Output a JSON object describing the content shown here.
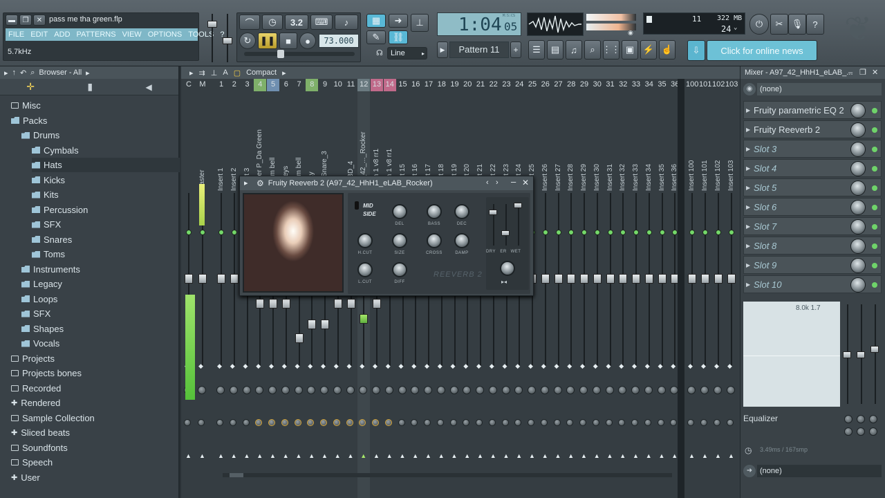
{
  "window": {
    "file_title": "pass me tha green.flp",
    "hint": "5.7kHz"
  },
  "menu": [
    "FILE",
    "EDIT",
    "ADD",
    "PATTERNS",
    "VIEW",
    "OPTIONS",
    "TOOLS",
    "?"
  ],
  "transport": {
    "tempo": "73.000",
    "time": "1:04",
    "time_sub": "05",
    "time_unit": "M:S:CS",
    "snap_label": "Line",
    "pattern": "Pattern 11",
    "record_mode": "3.2"
  },
  "status": {
    "cpu": "11",
    "memory": "322 MB",
    "polyphony": "24"
  },
  "news": "Click for online news",
  "browser": {
    "title": "Browser - All",
    "items": [
      {
        "label": "Misc",
        "type": "folder",
        "depth": 0
      },
      {
        "label": "Packs",
        "type": "pack",
        "depth": 0
      },
      {
        "label": "Drums",
        "type": "pack",
        "depth": 1
      },
      {
        "label": "Cymbals",
        "type": "pack",
        "depth": 2
      },
      {
        "label": "Hats",
        "type": "pack",
        "depth": 2
      },
      {
        "label": "Kicks",
        "type": "pack",
        "depth": 2
      },
      {
        "label": "Kits",
        "type": "pack",
        "depth": 2
      },
      {
        "label": "Percussion",
        "type": "pack",
        "depth": 2
      },
      {
        "label": "SFX",
        "type": "pack",
        "depth": 2
      },
      {
        "label": "Snares",
        "type": "pack",
        "depth": 2
      },
      {
        "label": "Toms",
        "type": "pack",
        "depth": 2
      },
      {
        "label": "Instruments",
        "type": "pack",
        "depth": 1
      },
      {
        "label": "Legacy",
        "type": "pack",
        "depth": 1
      },
      {
        "label": "Loops",
        "type": "pack",
        "depth": 1
      },
      {
        "label": "SFX",
        "type": "pack",
        "depth": 1
      },
      {
        "label": "Shapes",
        "type": "pack",
        "depth": 1
      },
      {
        "label": "Vocals",
        "type": "pack",
        "depth": 1
      },
      {
        "label": "Projects",
        "type": "folder",
        "depth": 0
      },
      {
        "label": "Projects bones",
        "type": "folder",
        "depth": 0
      },
      {
        "label": "Recorded",
        "type": "folder",
        "depth": 0
      },
      {
        "label": "Rendered",
        "type": "plus",
        "depth": 0
      },
      {
        "label": "Sample Collection",
        "type": "folder",
        "depth": 0
      },
      {
        "label": "Sliced beats",
        "type": "plus",
        "depth": 0
      },
      {
        "label": "Soundfonts",
        "type": "folder",
        "depth": 0
      },
      {
        "label": "Speech",
        "type": "folder",
        "depth": 0
      },
      {
        "label": "User",
        "type": "plus",
        "depth": 0
      }
    ]
  },
  "mixer": {
    "view": "Compact",
    "headers": [
      "C",
      "M",
      "1",
      "2",
      "3",
      "4",
      "5",
      "6",
      "7",
      "8",
      "9",
      "10",
      "11",
      "12",
      "13",
      "14",
      "15",
      "16",
      "17",
      "18",
      "19",
      "20",
      "21",
      "22",
      "23",
      "24",
      "25",
      "26",
      "27",
      "28",
      "29",
      "30",
      "31",
      "32",
      "33",
      "34",
      "35",
      "36",
      "100",
      "101",
      "102",
      "103"
    ],
    "names": [
      "Master",
      "Insert 1",
      "Insert 2",
      "Insert 3",
      "Master P_Da Green",
      "Dream bell",
      "FL Keys",
      "Dream bell",
      "Friday",
      "RD_Snare_3",
      "Saw",
      "VT_BD_4",
      "A97_42_..._Rocker",
      "crash 1 v8 rr1",
      "crash 1 v8 rr1",
      "Insert 15",
      "Insert 16",
      "Insert 17",
      "Insert 18",
      "Insert 19",
      "Insert 20",
      "Insert 21",
      "Insert 22",
      "Insert 23",
      "Insert 24",
      "Insert 25",
      "Insert 26",
      "Insert 27",
      "Insert 28",
      "Insert 29",
      "Insert 30",
      "Insert 31",
      "Insert 32",
      "Insert 33",
      "Insert 34",
      "Insert 35",
      "Insert 36",
      "Insert 100",
      "Insert 101",
      "Insert 102",
      "Insert 103"
    ]
  },
  "plugin": {
    "title": "Fruity Reeverb 2 (A97_42_HhH1_eLAB_Rocker)",
    "mid_side": [
      "MID",
      "SIDE"
    ],
    "knobs": [
      "DEL",
      "BASS",
      "DEC",
      "H.CUT",
      "SIZE",
      "CROSS",
      "DAMP",
      "L.CUT",
      "DIFF"
    ],
    "faders": [
      "DRY",
      "ER",
      "WET"
    ],
    "brand": "REEVERB 2"
  },
  "mixer_panel": {
    "title": "Mixer - A97_42_HhH1_eLAB_...",
    "input": "(none)",
    "output": "(none)",
    "slots": [
      "Fruity parametric EQ 2",
      "Fruity Reeverb 2",
      "Slot 3",
      "Slot 4",
      "Slot 5",
      "Slot 6",
      "Slot 7",
      "Slot 8",
      "Slot 9",
      "Slot 10"
    ],
    "eq_readout": "8.0k 1.7",
    "eq_label": "Equalizer",
    "latency": "3.49ms / 167smp"
  },
  "colors": {
    "accent_green": "#74d86a",
    "lcd": "#8fbcc6",
    "selected_column": "#ffffff"
  }
}
